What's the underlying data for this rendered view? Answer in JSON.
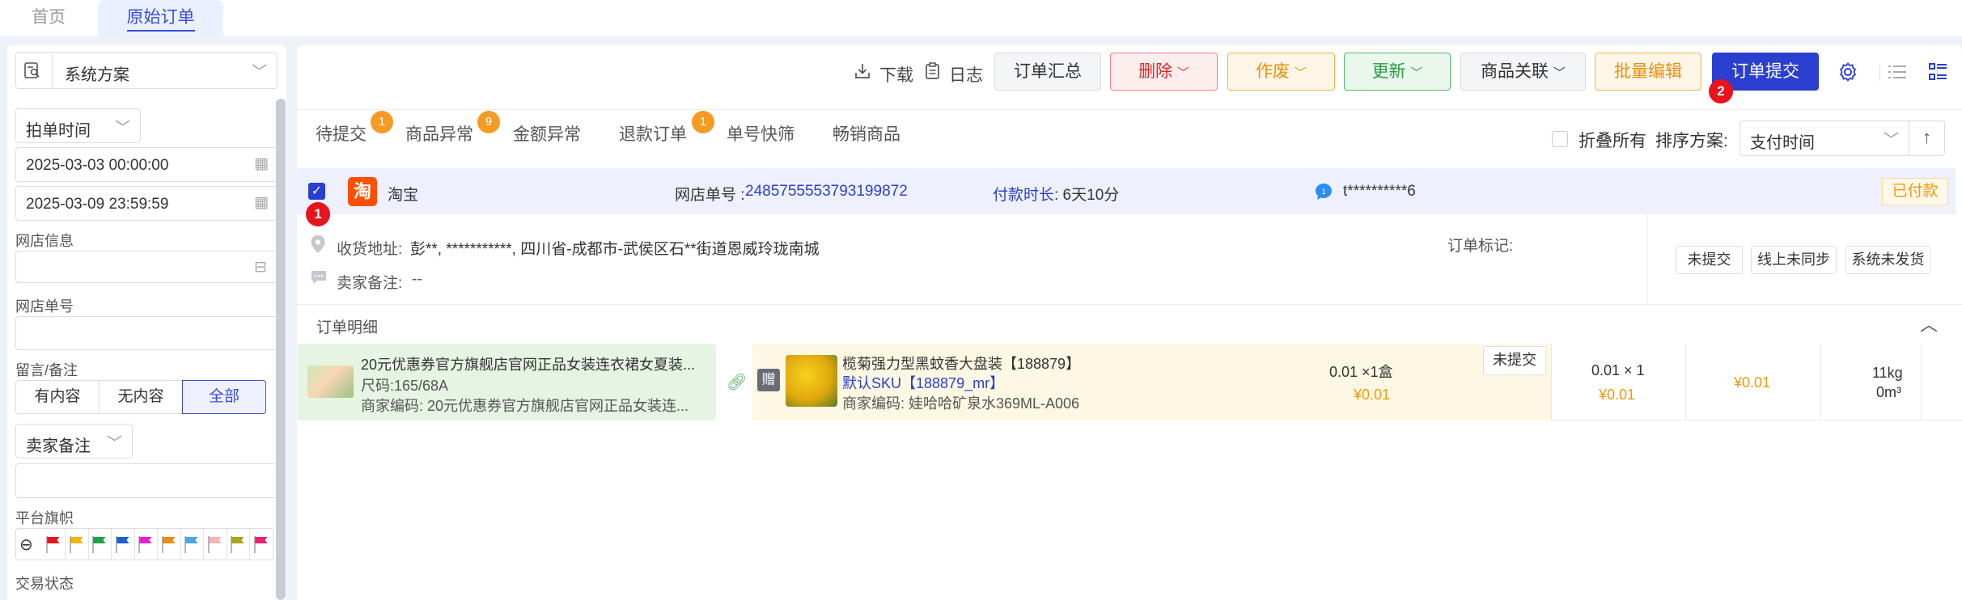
{
  "top_tabs": [
    "首页",
    "原始订单"
  ],
  "sidebar": {
    "scheme": "系统方案",
    "time_type": "拍单时间",
    "date_start": "2025-03-03 00:00:00",
    "date_end": "2025-03-09 23:59:59",
    "shop_info_label": "网店信息",
    "shop_order_label": "网店单号",
    "remark_label": "留言/备注",
    "remark_options": [
      "有内容",
      "无内容",
      "全部"
    ],
    "seller_remark": "卖家备注",
    "platform_flag_label": "平台旗帜",
    "flag_colors": [
      "#e8141b",
      "#f5b400",
      "#1aa34a",
      "#1a62d8",
      "#e51fd6",
      "#f08a12",
      "#4aa6e8",
      "#f2b5b5",
      "#a8a619",
      "#e81e78"
    ],
    "trade_status_label": "交易状态"
  },
  "toolbar": {
    "download": "下载",
    "log": "日志",
    "summary": "订单汇总",
    "delete": "删除",
    "void": "作废",
    "update": "更新",
    "product_link": "商品关联",
    "batch_edit": "批量编辑",
    "submit": "订单提交",
    "submit_badge": "2"
  },
  "status_tabs": [
    {
      "label": "待提交",
      "badge": "1"
    },
    {
      "label": "商品异常",
      "badge": "9"
    },
    {
      "label": "金额异常",
      "badge": ""
    },
    {
      "label": "退款订单",
      "badge": "1"
    },
    {
      "label": "单号快筛",
      "badge": ""
    },
    {
      "label": "畅销商品",
      "badge": ""
    }
  ],
  "collapse_all": "折叠所有",
  "sort_label": "排序方案:",
  "sort_value": "支付时间",
  "order": {
    "platform_icon": "淘",
    "platform": "淘宝",
    "shop_order_label": "网店单号 : ",
    "shop_order_no": "2485755553793199872",
    "pay_duration_label": "付款时长",
    "pay_duration": " : 6天10分",
    "buyer": "t**********6",
    "status": "已付款",
    "row_badge": "1",
    "address_label": "收货地址:",
    "address": "彭**, ***********, 四川省-成都市-武侯区石**街道恩威玲珑南城",
    "seller_remark_label": "卖家备注:",
    "seller_remark": "--",
    "mark_label": "订单标记:",
    "tags": [
      "未提交",
      "线上未同步",
      "系统未发货"
    ]
  },
  "detail": {
    "header": "订单明细",
    "item1": {
      "title": "20元优惠券官方旗舰店官网正品女装连衣裙女夏装...",
      "size": "尺码:165/68A",
      "code": "商家编码: 20元优惠券官方旗舰店官网正品女装连..."
    },
    "item2": {
      "gift": "赠",
      "title": "榄菊强力型黑蚊香大盘装【188879】",
      "sku": "默认SKU【188879_mr】",
      "code": "商家编码: 娃哈哈矿泉水369ML-A006",
      "price_qty": "0.01 ×1盒",
      "price": "¥0.01",
      "status": "未提交"
    },
    "col_price_qty": "0.01 × 1",
    "col_price": "¥0.01",
    "col_amount": "¥0.01",
    "col_weight": "11kg",
    "col_volume": "0m³"
  }
}
